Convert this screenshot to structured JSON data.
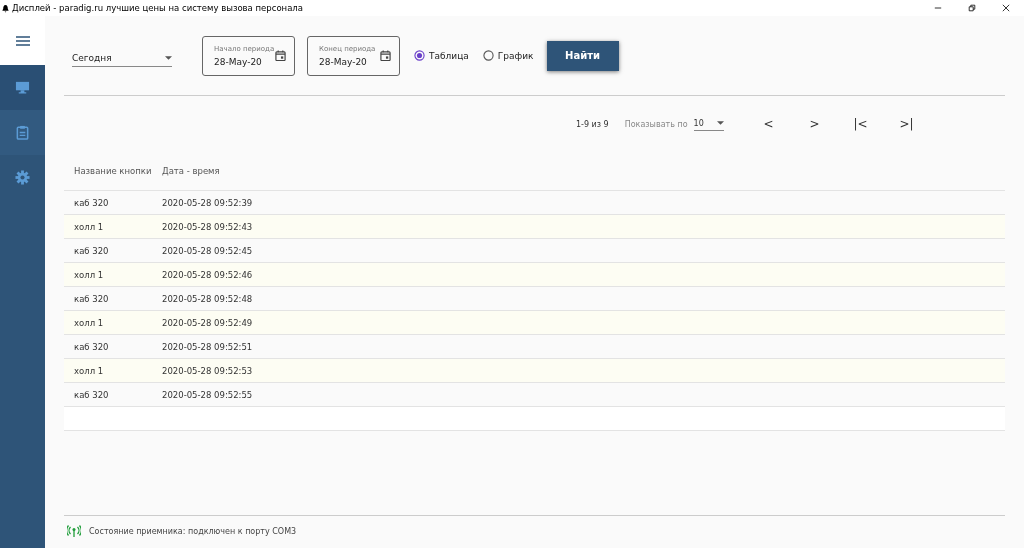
{
  "window": {
    "title": "Дисплей - paradig.ru лучшие цены на систему вызова персонала"
  },
  "filters": {
    "period": "Сегодня",
    "start": {
      "label": "Начало периода",
      "value": "28-May-20"
    },
    "end": {
      "label": "Конец периода",
      "value": "28-May-20"
    },
    "views": [
      {
        "label": "Таблица",
        "selected": true
      },
      {
        "label": "График",
        "selected": false
      }
    ],
    "search_button": "Найти"
  },
  "pagination": {
    "range": "1-9 из 9",
    "per_page_label": "Показывать по",
    "per_page": "10",
    "buttons": [
      "<",
      ">",
      "|<",
      ">|"
    ]
  },
  "table": {
    "columns": [
      "Название кнопки",
      "Дата - время"
    ],
    "rows": [
      [
        "каб 320",
        "2020-05-28 09:52:39"
      ],
      [
        "холл 1",
        "2020-05-28 09:52:43"
      ],
      [
        "каб 320",
        "2020-05-28 09:52:45"
      ],
      [
        "холл 1",
        "2020-05-28 09:52:46"
      ],
      [
        "каб 320",
        "2020-05-28 09:52:48"
      ],
      [
        "холл 1",
        "2020-05-28 09:52:49"
      ],
      [
        "каб 320",
        "2020-05-28 09:52:51"
      ],
      [
        "холл 1",
        "2020-05-28 09:52:53"
      ],
      [
        "каб 320",
        "2020-05-28 09:52:55"
      ]
    ]
  },
  "status_bar": "Состояние приемника: подключен к порту COM3"
}
